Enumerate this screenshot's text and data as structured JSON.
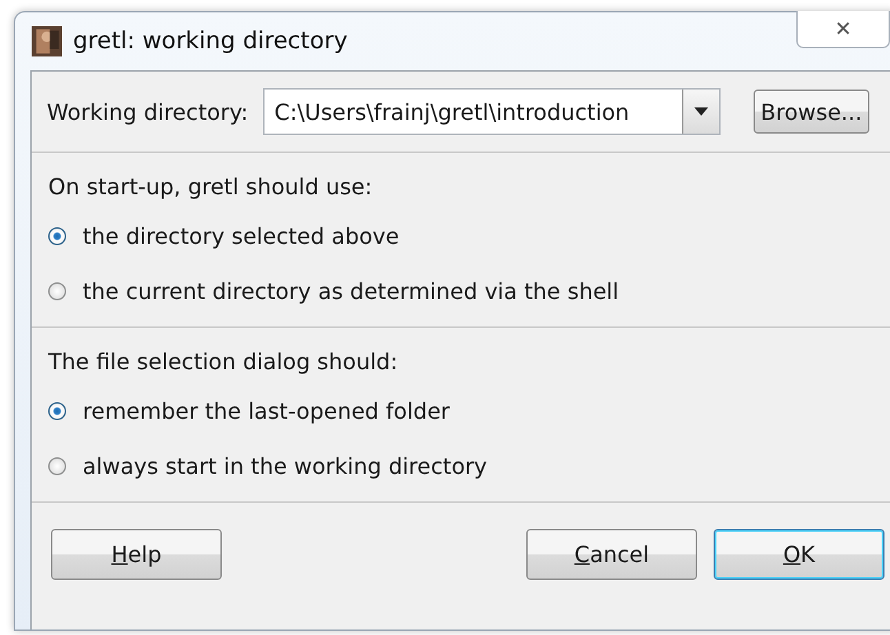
{
  "window": {
    "title": "gretl: working directory",
    "close": "✕"
  },
  "working_directory": {
    "label": "Working directory:",
    "value": "C:\\Users\\frainj\\gretl\\introduction",
    "browse": "Browse..."
  },
  "groups": [
    {
      "heading": "On start-up, gretl should use:",
      "options": [
        {
          "label": "the directory selected above",
          "selected": true
        },
        {
          "label": "the current directory as determined via the shell",
          "selected": false
        }
      ]
    },
    {
      "heading": "The file selection dialog should:",
      "options": [
        {
          "label": "remember the last-opened folder",
          "selected": true
        },
        {
          "label": "always start in the working directory",
          "selected": false
        }
      ]
    }
  ],
  "buttons": [
    {
      "accel": "H",
      "rest": "elp",
      "kind": "help"
    },
    {
      "accel": "C",
      "rest": "ancel",
      "kind": "cancel"
    },
    {
      "accel": "O",
      "rest": "K",
      "kind": "default"
    }
  ]
}
